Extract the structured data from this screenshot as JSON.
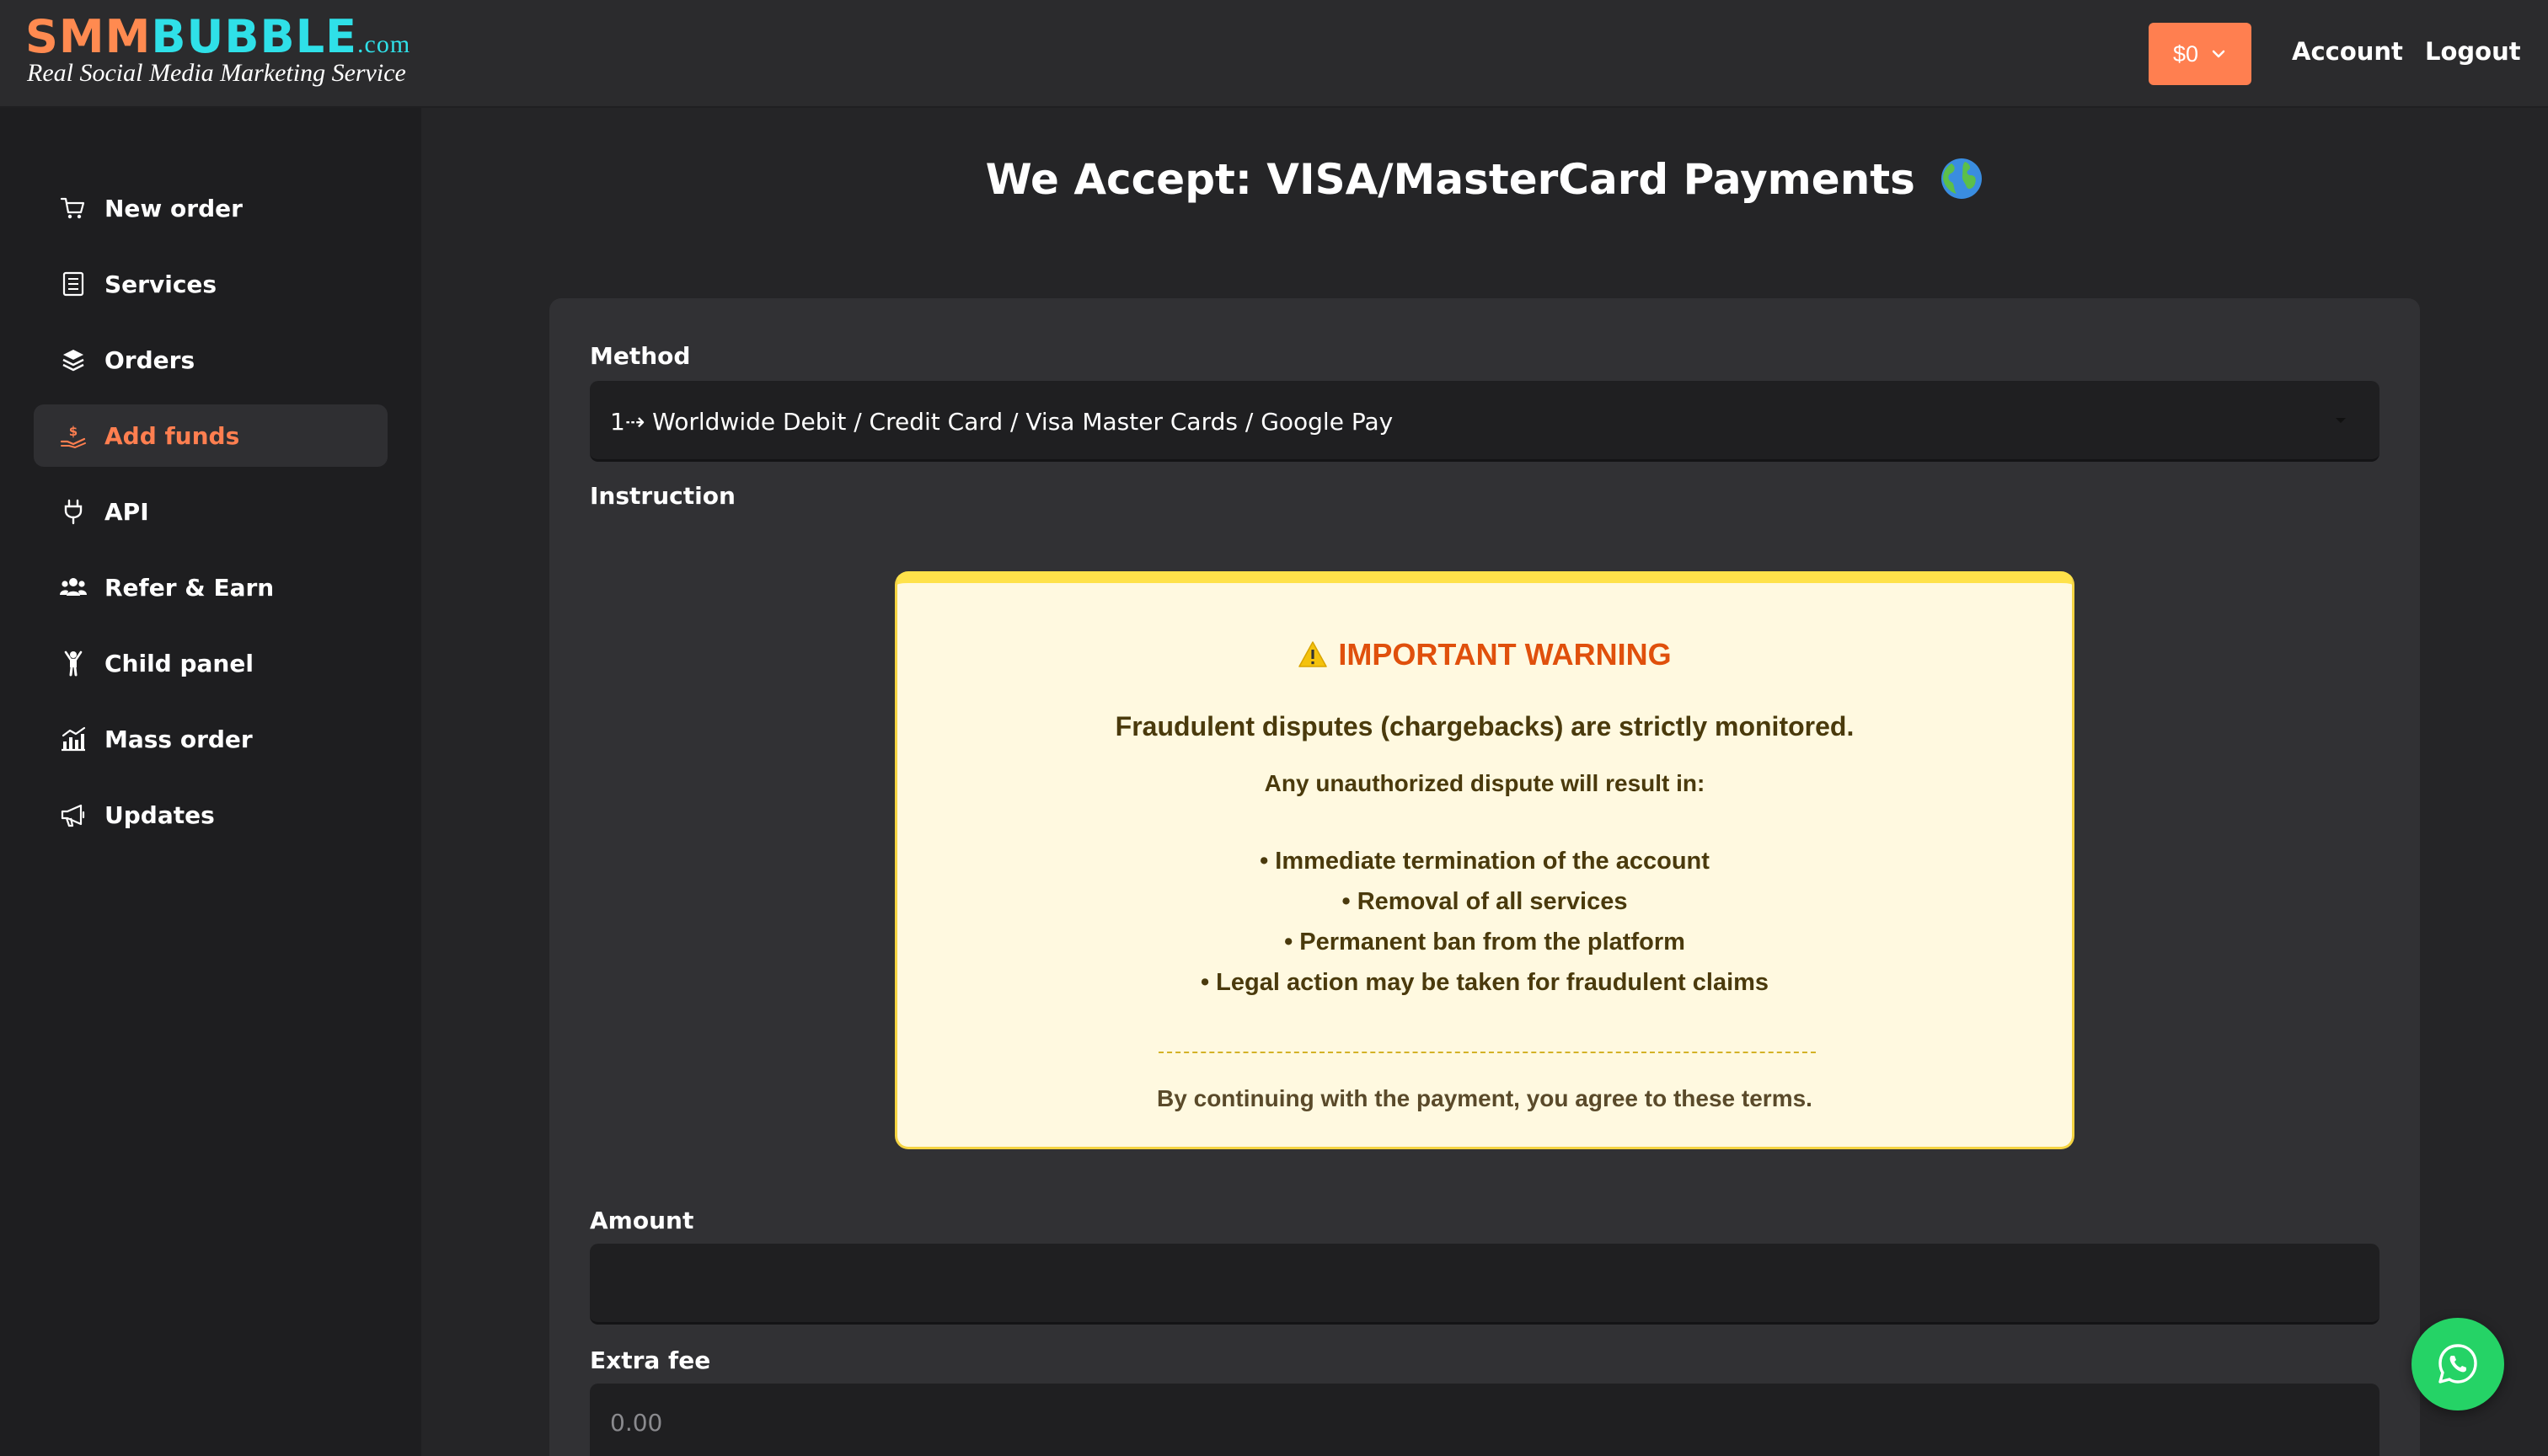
{
  "header": {
    "logo_smm": "SMM",
    "logo_bubble": "BUBBLE",
    "logo_com": ".com",
    "logo_tagline": "Real Social Media Marketing Service",
    "balance": "$0",
    "account_label": "Account",
    "logout_label": "Logout",
    "accent_color": "#ff7f50"
  },
  "sidebar": {
    "items": [
      {
        "label": "New order",
        "icon": "cart-icon"
      },
      {
        "label": "Services",
        "icon": "list-icon"
      },
      {
        "label": "Orders",
        "icon": "layers-icon"
      },
      {
        "label": "Add funds",
        "icon": "hand-money-icon",
        "active": true
      },
      {
        "label": "API",
        "icon": "plug-icon"
      },
      {
        "label": "Refer & Earn",
        "icon": "users-icon"
      },
      {
        "label": "Child panel",
        "icon": "child-icon"
      },
      {
        "label": "Mass order",
        "icon": "chart-icon"
      },
      {
        "label": "Updates",
        "icon": "megaphone-icon"
      }
    ]
  },
  "main": {
    "title": "We Accept: VISA/MasterCard Payments",
    "method_label": "Method",
    "method_value": "1⇢ Worldwide Debit / Credit Card / Visa Master Cards / Google Pay",
    "instruction_label": "Instruction",
    "warning": {
      "title": "IMPORTANT WARNING",
      "lead": "Fraudulent disputes (chargebacks) are strictly monitored.",
      "sub": "Any unauthorized dispute will result in:",
      "items": [
        "• Immediate termination of the account",
        "• Removal of all services",
        "• Permanent ban from the platform",
        "• Legal action may be taken for fraudulent claims"
      ],
      "footer": "By continuing with the payment, you agree to these terms."
    },
    "amount_label": "Amount",
    "amount_value": "",
    "extra_fee_label": "Extra fee",
    "extra_fee_placeholder": "0.00"
  },
  "floating": {
    "whatsapp_icon": "whatsapp-icon",
    "whatsapp_color": "#25d366"
  }
}
